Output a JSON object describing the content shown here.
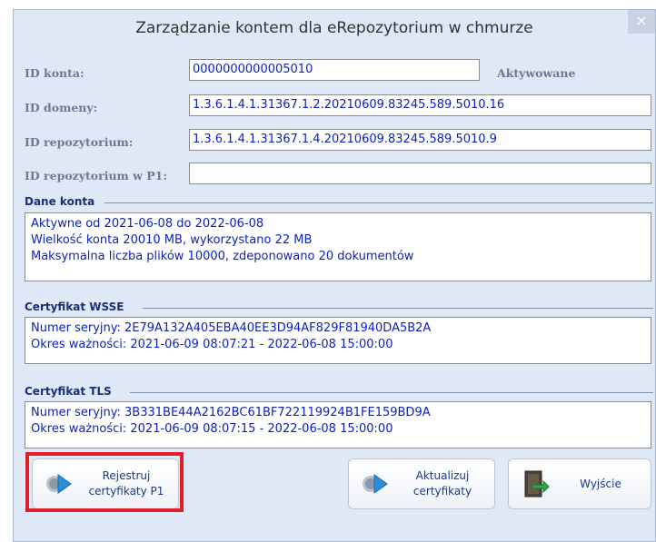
{
  "window": {
    "title": "Zarządzanie kontem dla eRepozytorium w chmurze",
    "close_glyph": "×"
  },
  "fields": {
    "account_id": {
      "label": "ID konta:",
      "value": "0000000000005010",
      "status": "Aktywowane"
    },
    "domain_id": {
      "label": "ID domeny:",
      "value": "1.3.6.1.4.1.31367.1.2.20210609.83245.589.5010.16"
    },
    "repository_id": {
      "label": "ID repozytorium:",
      "value": "1.3.6.1.4.1.31367.1.4.20210609.83245.589.5010.9"
    },
    "repository_id_p1": {
      "label": "ID repozytorium w P1:",
      "value": ""
    }
  },
  "sections": {
    "account_data": {
      "title": "Dane konta",
      "lines": [
        "Aktywne od 2021-06-08 do 2022-06-08",
        "Wielkość konta 20010 MB, wykorzystano 22 MB",
        "Maksymalna liczba plików 10000, zdeponowano 20 dokumentów"
      ]
    },
    "wsse_cert": {
      "title": "Certyfikat WSSE",
      "lines": [
        "Numer seryjny: 2E79A132A405EBA40EE3D94AF829F81940DA5B2A",
        "Okres ważności: 2021-06-09 08:07:21 - 2022-06-08 15:00:00"
      ]
    },
    "tls_cert": {
      "title": "Certyfikat TLS",
      "lines": [
        "Numer seryjny: 3B331BE44A2162BC61BF722119924B1FE159BD9A",
        "Okres ważności: 2021-06-09 08:07:15 - 2022-06-08 15:00:00"
      ]
    }
  },
  "buttons": {
    "register_p1": {
      "line1": "Rejestruj",
      "line2": "certyfikaty P1",
      "icon": "arrow-right-icon"
    },
    "update": {
      "line1": "Aktualizuj",
      "line2": "certyfikaty",
      "icon": "arrow-right-icon"
    },
    "exit": {
      "label": "Wyjście",
      "icon": "exit-door-icon"
    }
  },
  "colors": {
    "background": "#dfe8f6",
    "field_text": "#0b1fbd",
    "section_title": "#1a2e7a",
    "highlight": "#e01e27"
  }
}
